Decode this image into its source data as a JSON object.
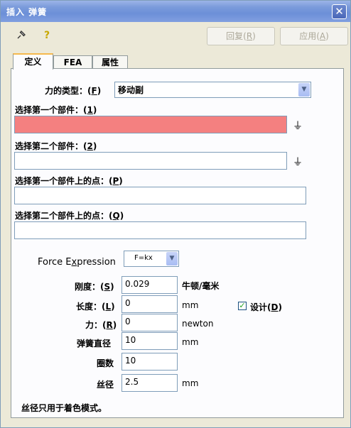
{
  "window": {
    "title": "插入 弹簧"
  },
  "toolbar": {
    "pin_icon": "pushpin-icon",
    "help_icon": "help-icon",
    "restore_label": "回复",
    "restore_key": "R",
    "apply_label": "应用",
    "apply_key": "A"
  },
  "tabs": [
    {
      "label": "定义",
      "active": true
    },
    {
      "label": "FEA"
    },
    {
      "label": "属性"
    }
  ],
  "define": {
    "force_type_label": "力的类型：",
    "force_type_key": "F",
    "force_type_value": "移动副",
    "part1_label": "选择第一个部件：",
    "part1_key": "1",
    "part1_value": "",
    "part2_label": "选择第二个部件：",
    "part2_key": "2",
    "part2_value": "",
    "point1_label": "选择第一个部件上的点：",
    "point1_key": "P",
    "point1_value": "",
    "point2_label": "选择第二个部件上的点：",
    "point2_key": "Q",
    "point2_value": "",
    "force_expr_label_a": "Force E",
    "force_expr_label_key": "x",
    "force_expr_label_b": "pression",
    "force_expr_value": "F=kx",
    "stiffness_label": "刚度：",
    "stiffness_key": "S",
    "stiffness_value": "0.029",
    "stiffness_unit": "牛顿/毫米",
    "length_label": "长度：",
    "length_key": "L",
    "length_value": "0",
    "length_unit": "mm",
    "force_label": "力：",
    "force_key": "R",
    "force_value": "0",
    "force_unit": "newton",
    "design_label": "设计",
    "design_key": "D",
    "design_checked": true,
    "coil_diameter_label": "弹簧直径",
    "coil_diameter_value": "10",
    "coil_diameter_unit": "mm",
    "turns_label": "圈数",
    "turns_value": "10",
    "wire_diameter_label": "丝径",
    "wire_diameter_value": "2.5",
    "wire_diameter_unit": "mm",
    "note": "丝径只用于着色模式。"
  },
  "colors": {
    "selected_field": "#f48080",
    "title_gradient": "#7b9bdb"
  }
}
